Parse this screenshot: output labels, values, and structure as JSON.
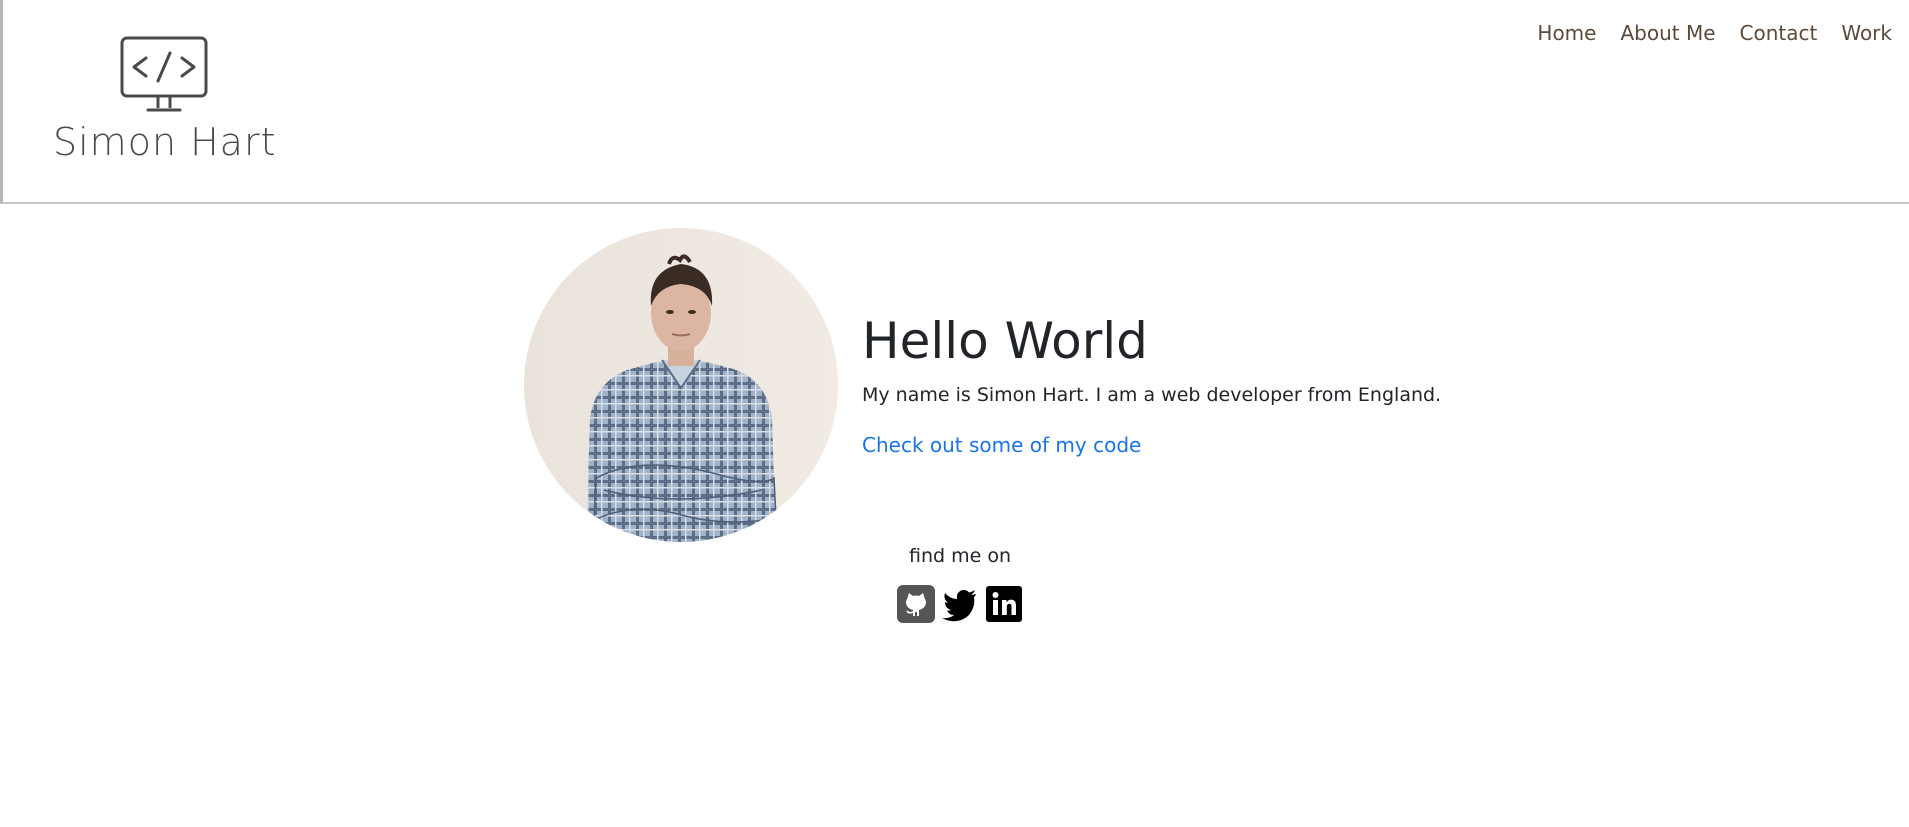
{
  "header": {
    "logo_text": "Simon Hart",
    "logo_icon": "code-monitor-icon",
    "nav": [
      {
        "label": "Home"
      },
      {
        "label": "About Me"
      },
      {
        "label": "Contact"
      },
      {
        "label": "Work"
      }
    ]
  },
  "main": {
    "title": "Hello World",
    "intro": "My name is Simon Hart. I am a web developer from England.",
    "code_link": "Check out some of my code"
  },
  "social": {
    "label": "find me on",
    "icons": [
      "github-icon",
      "twitter-icon",
      "linkedin-icon"
    ]
  },
  "colors": {
    "nav_text": "#5c4a3a",
    "link": "#1a73e8",
    "text": "#212529"
  }
}
